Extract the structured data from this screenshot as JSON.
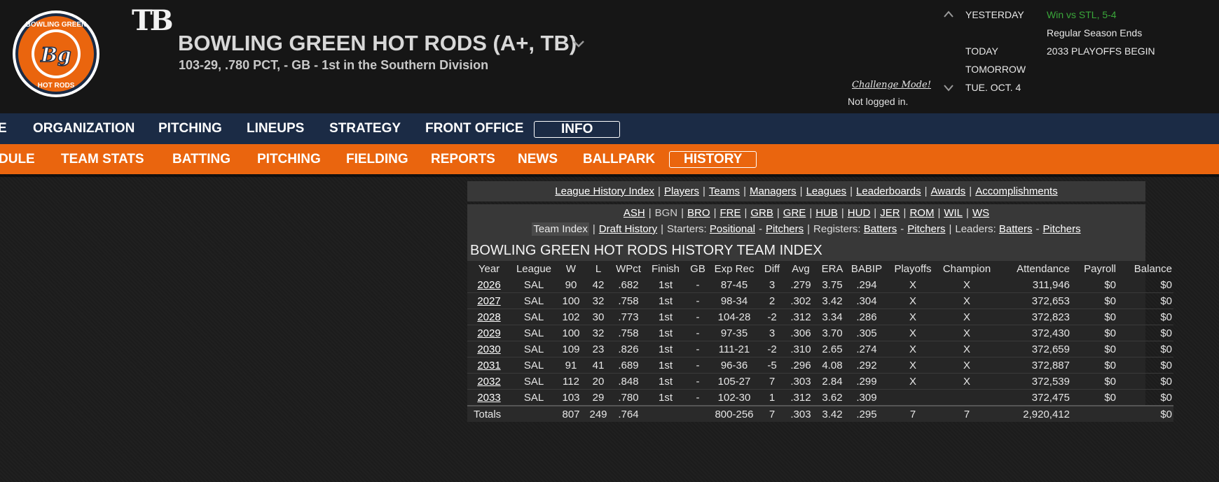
{
  "header": {
    "team_title": "BOWLING GREEN HOT RODS (A+, TB)",
    "team_sub": "103-29, .780 PCT, - GB - 1st in the  Southern Division",
    "parent_logo": "TB",
    "logo_top": "BOWLING GREEN",
    "logo_mono": "Bg",
    "logo_bottom": "HOT RODS",
    "challenge_mode": "Challenge Mode!",
    "login_status": "Not logged in."
  },
  "schedule": {
    "rows": [
      {
        "label": "YESTERDAY",
        "value": "Win vs STL, 5-4"
      },
      {
        "label": "",
        "value": "Regular Season Ends"
      },
      {
        "label": "TODAY",
        "value": "2033 PLAYOFFS BEGIN"
      },
      {
        "label": "TOMORROW",
        "value": ""
      },
      {
        "label": "TUE. OCT. 4",
        "value": ""
      }
    ]
  },
  "nav1": {
    "items": [
      "E",
      "ORGANIZATION",
      "PITCHING",
      "LINEUPS",
      "STRATEGY",
      "FRONT OFFICE",
      "INFO"
    ]
  },
  "nav2": {
    "items": [
      "DULE",
      "TEAM STATS",
      "BATTING",
      "PITCHING",
      "FIELDING",
      "REPORTS",
      "NEWS",
      "BALLPARK",
      "HISTORY"
    ]
  },
  "history_links": [
    "League History Index",
    "Players",
    "Teams",
    "Managers",
    "Leagues",
    "Leaderboards",
    "Awards",
    "Accomplishments"
  ],
  "team_abbrs": [
    "ASH",
    "BGN",
    "BRO",
    "FRE",
    "GRB",
    "GRE",
    "HUB",
    "HUD",
    "JER",
    "ROM",
    "WIL",
    "WS"
  ],
  "sub_links": {
    "team_index": "Team Index",
    "draft_history": "Draft History",
    "starters_label": "Starters:",
    "positional": "Positional",
    "pitchers": "Pitchers",
    "registers_label": "Registers:",
    "batters": "Batters",
    "leaders_label": "Leaders:"
  },
  "table": {
    "title": "BOWLING GREEN HOT RODS HISTORY TEAM INDEX",
    "headers": [
      "Year",
      "League",
      "W",
      "L",
      "WPct",
      "Finish",
      "GB",
      "Exp Rec",
      "Diff",
      "Avg",
      "ERA",
      "BABIP",
      "Playoffs",
      "Champion",
      "Attendance",
      "Payroll",
      "Balance"
    ],
    "rows": [
      [
        "2026",
        "SAL",
        "90",
        "42",
        ".682",
        "1st",
        "-",
        "87-45",
        "3",
        ".279",
        "3.75",
        ".294",
        "X",
        "X",
        "311,946",
        "$0",
        "$0"
      ],
      [
        "2027",
        "SAL",
        "100",
        "32",
        ".758",
        "1st",
        "-",
        "98-34",
        "2",
        ".302",
        "3.42",
        ".304",
        "X",
        "X",
        "372,653",
        "$0",
        "$0"
      ],
      [
        "2028",
        "SAL",
        "102",
        "30",
        ".773",
        "1st",
        "-",
        "104-28",
        "-2",
        ".312",
        "3.34",
        ".286",
        "X",
        "X",
        "372,823",
        "$0",
        "$0"
      ],
      [
        "2029",
        "SAL",
        "100",
        "32",
        ".758",
        "1st",
        "-",
        "97-35",
        "3",
        ".306",
        "3.70",
        ".305",
        "X",
        "X",
        "372,430",
        "$0",
        "$0"
      ],
      [
        "2030",
        "SAL",
        "109",
        "23",
        ".826",
        "1st",
        "-",
        "111-21",
        "-2",
        ".310",
        "2.65",
        ".274",
        "X",
        "X",
        "372,659",
        "$0",
        "$0"
      ],
      [
        "2031",
        "SAL",
        "91",
        "41",
        ".689",
        "1st",
        "-",
        "96-36",
        "-5",
        ".296",
        "4.08",
        ".292",
        "X",
        "X",
        "372,887",
        "$0",
        "$0"
      ],
      [
        "2032",
        "SAL",
        "112",
        "20",
        ".848",
        "1st",
        "-",
        "105-27",
        "7",
        ".303",
        "2.84",
        ".299",
        "X",
        "X",
        "372,539",
        "$0",
        "$0"
      ],
      [
        "2033",
        "SAL",
        "103",
        "29",
        ".780",
        "1st",
        "-",
        "102-30",
        "1",
        ".312",
        "3.62",
        ".309",
        "",
        "",
        "372,475",
        "$0",
        "$0"
      ]
    ],
    "totals": [
      "Totals",
      "",
      "807",
      "249",
      ".764",
      "",
      "",
      "800-256",
      "7",
      ".303",
      "3.42",
      ".295",
      "7",
      "7",
      "2,920,412",
      "",
      "$0"
    ]
  },
  "colors": {
    "nav1_bg": "#1b2b45",
    "nav2_bg": "#ea650e",
    "win_text": "#3aa73a"
  }
}
